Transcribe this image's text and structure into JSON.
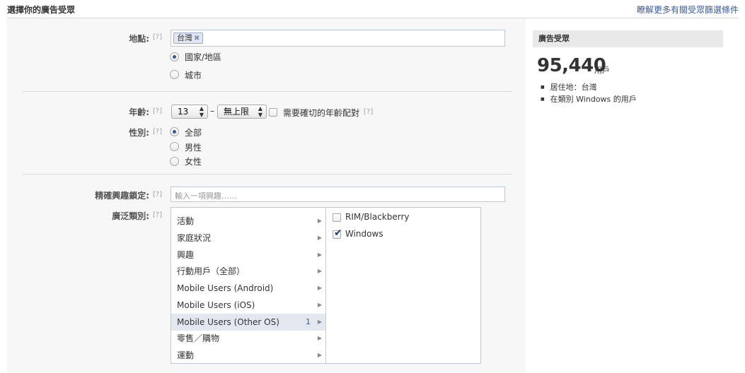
{
  "header": {
    "title": "選擇你的廣告受眾",
    "learn_more_link": "瞭解更多有關受眾篩選條件"
  },
  "help_marker": "[?]",
  "location": {
    "label": "地點:",
    "token": "台灣",
    "token_remove": "✖",
    "options": [
      {
        "label": "國家/地區",
        "selected": true
      },
      {
        "label": "城市",
        "selected": false
      }
    ]
  },
  "age": {
    "label": "年齡:",
    "min_value": "13",
    "separator": "–",
    "max_value": "無上限",
    "exact_match_label": "需要確切的年齡配對",
    "exact_match_checked": false
  },
  "gender": {
    "label": "性別:",
    "options": [
      {
        "label": "全部",
        "selected": true
      },
      {
        "label": "男性",
        "selected": false
      },
      {
        "label": "女性",
        "selected": false
      }
    ]
  },
  "precise_interests": {
    "label": "精確興趣鎖定:",
    "placeholder": "輸入一項興趣……"
  },
  "broad_categories": {
    "label": "廣泛類別:",
    "categories": [
      {
        "label": "活動",
        "count": ""
      },
      {
        "label": "家庭狀況",
        "count": ""
      },
      {
        "label": "興趣",
        "count": ""
      },
      {
        "label": "行動用戶（全部）",
        "count": ""
      },
      {
        "label": "Mobile Users (Android)",
        "count": ""
      },
      {
        "label": "Mobile Users (iOS)",
        "count": ""
      },
      {
        "label": "Mobile Users (Other OS)",
        "count": "1"
      },
      {
        "label": "零售／購物",
        "count": ""
      },
      {
        "label": "運動",
        "count": ""
      }
    ],
    "selected_category_index": 6,
    "subcategories": [
      {
        "label": "RIM/Blackberry",
        "checked": false
      },
      {
        "label": "Windows",
        "checked": true
      }
    ]
  },
  "audience": {
    "heading": "廣告受眾",
    "count": "95,440",
    "unit": "用戶",
    "criteria": [
      "居住地：台灣",
      "在類別 Windows 的用戶"
    ]
  },
  "icons": {
    "arrow": "▶",
    "select_arrows": "▲▼",
    "check": "✔"
  },
  "colors": {
    "link": "#3b5998",
    "panel_bg": "#f7f7f7",
    "selected_row_bg": "#e3e7ef"
  }
}
